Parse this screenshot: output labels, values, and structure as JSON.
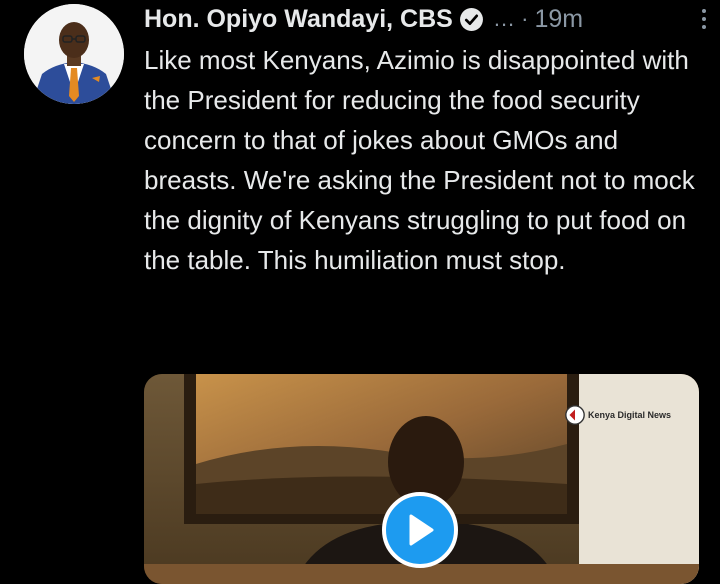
{
  "tweet": {
    "author_name": "Hon. Opiyo Wandayi, CBS",
    "handle_truncated": "...",
    "separator": "·",
    "time": "19m",
    "text": "Like most Kenyans, Azimio is disappointed with the President for reducing the food security concern to that of jokes about GMOs and breasts. We're asking the President not to mock the dignity of Kenyans struggling to put food on the table. This humiliation must stop."
  },
  "media": {
    "watermark": "Kenya Digital News",
    "play_icon": "play-icon"
  },
  "colors": {
    "background": "#000000",
    "text": "#e7e9ea",
    "muted": "#8b98a5",
    "accent": "#1d9bf0"
  },
  "icons": [
    "verified-badge-icon",
    "more-options-icon",
    "play-icon"
  ]
}
